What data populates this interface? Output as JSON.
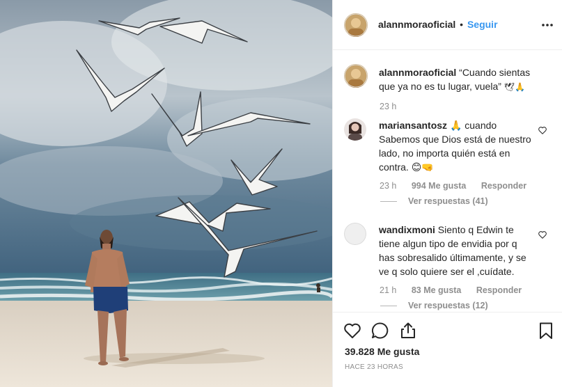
{
  "post": {
    "username": "alannmoraoficial",
    "separator": "•",
    "follow_label": "Seguir"
  },
  "caption": {
    "username": "alannmoraoficial",
    "text": "“Cuando sientas que ya no es tu lugar, vuela”",
    "emoji": "🕊🙏",
    "time": "23 h"
  },
  "comments": [
    {
      "username": "mariansantosz",
      "text": "🙏 cuando Sabemos que Dios está de nuestro lado, no importa quién está en contra. 😊🤜",
      "time": "23 h",
      "likes": "994 Me gusta",
      "reply_label": "Responder",
      "replies_label": "Ver respuestas (41)"
    },
    {
      "username": "wandixmoni",
      "text": "Siento q Edwin te tiene algun tipo de envidia por q has sobresalido últimamente, y se ve q solo quiere ser el ,cuídate.",
      "time": "21 h",
      "likes": "83 Me gusta",
      "reply_label": "Responder",
      "replies_label": "Ver respuestas (12)"
    }
  ],
  "footer": {
    "likes": "39.828 Me gusta",
    "timestamp": "HACE 23 HORAS"
  },
  "icons": {
    "more": "more-dots-icon",
    "like": "heart-icon",
    "comment": "comment-bubble-icon",
    "share": "share-icon",
    "save": "bookmark-icon"
  },
  "colors": {
    "accent": "#3897f0",
    "muted": "#8e8e8e",
    "text": "#262626"
  }
}
